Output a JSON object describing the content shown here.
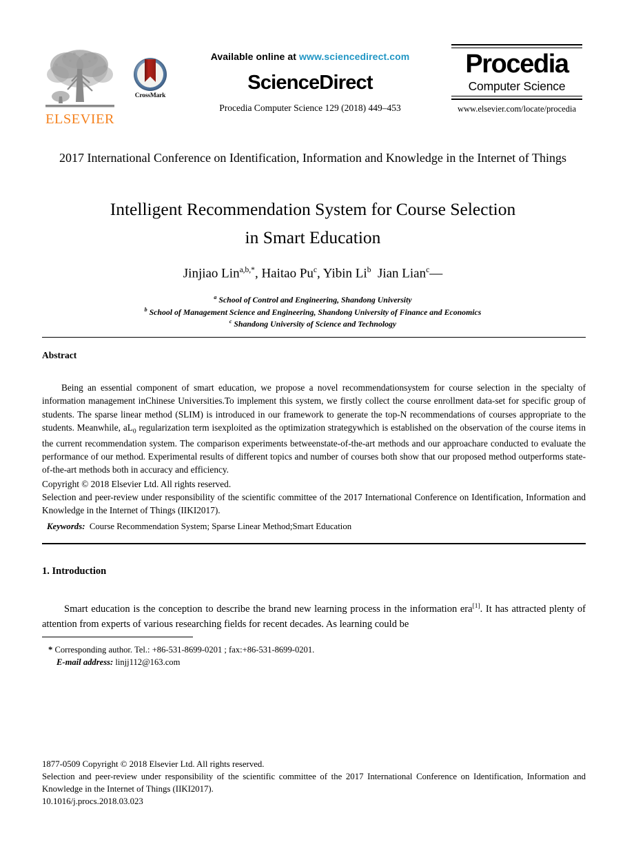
{
  "masthead": {
    "elsevier": {
      "wordmark": "ELSEVIER",
      "icon_name": "elsevier-tree-icon"
    },
    "crossmark": {
      "label": "CrossMark",
      "icon_name": "crossmark-badge-icon"
    },
    "sciencedirect": {
      "available_prefix": "Available online at ",
      "url": "www.sciencedirect.com",
      "wordmark": "ScienceDirect",
      "citation": "Procedia Computer Science 129 (2018) 449–453"
    },
    "procedia": {
      "title": "Procedia",
      "subtitle": "Computer Science",
      "url": "www.elsevier.com/locate/procedia"
    }
  },
  "article": {
    "conference": "2017 International Conference on Identification, Information and Knowledge in the Internet of Things",
    "title_line1": "Intelligent Recommendation System for Course Selection",
    "title_line2": "in Smart Education",
    "authors_html": "Jinjiao Lin<sup>a,b,*</sup>, Haitao Pu<sup>c</sup>, Yibin Li<sup>b</sup>&nbsp; Jian Lian<sup>c</sup>—",
    "affiliations": [
      "School of Control and Engineering, Shandong University",
      "School of Management Science and Engineering, Shandong University of Finance and Economics",
      "Shandong University of Science and Technology"
    ],
    "affiliation_markers": [
      "a",
      "b",
      "c"
    ]
  },
  "abstract": {
    "heading": "Abstract",
    "body_part1": "Being an essential component of smart education, we propose a novel recommendationsystem for course selection in the specialty of information management inChinese Universities.To implement this system, we firstly collect the course enrollment data-set for specific group of students. The sparse linear method (SLIM) is introduced in our framework to generate the top-N recommendations of courses appropriate to the  students. Meanwhile, aL",
    "body_sub": "0",
    "body_part2": " regularization term isexploited as the optimization strategywhich is established on the observation of the course items in the current recommendation system. The comparison experiments betweenstate-of-the-art methods and our approachare conducted to evaluate the performance of our method. Experimental results of different topics and number of courses both show that our proposed method outperforms state-of-the-art methods both in accuracy and efficiency.",
    "copyright": "Copyright © 2018 Elsevier Ltd. All rights reserved.",
    "peer_review": "Selection and peer-review under responsibility of the scientific committee of the 2017 International Conference on Identification, Information and Knowledge in the Internet of Things (IIKI2017).",
    "keywords_label": "Keywords:",
    "keywords_value": "Course Recommendation System; Sparse Linear Method;Smart Education"
  },
  "introduction": {
    "heading": "1. Introduction",
    "body_part1": "Smart education is the conception to describe the brand new learning process in the information era",
    "citation": "[1]",
    "body_part2": ". It has attracted plenty of attention from experts of various researching fields for recent decades. As learning could be"
  },
  "footnote": {
    "marker": "*",
    "corresponding": " Corresponding author. Tel.: +86-531-8699-0201 ; fax:+86-531-8699-0201.",
    "email_label": "E-mail address:",
    "email_value": " linjj112@163.com"
  },
  "footer": {
    "issn_copyright": "1877-0509 Copyright © 2018 Elsevier Ltd. All rights reserved.",
    "peer_review": "Selection and peer-review under responsibility of the scientific committee of the 2017 International Conference on Identification, Information and Knowledge in the Internet of Things (IIKI2017).",
    "doi": "10.1016/j.procs.2018.03.023"
  },
  "colors": {
    "elsevier_orange": "#f5821f",
    "sciencedirect_link_blue": "#2196c4",
    "crossmark_ribbon_red": "#b4231a",
    "crossmark_circle_blue": "#5b7fa6",
    "text_black": "#000000",
    "page_background": "#ffffff"
  }
}
